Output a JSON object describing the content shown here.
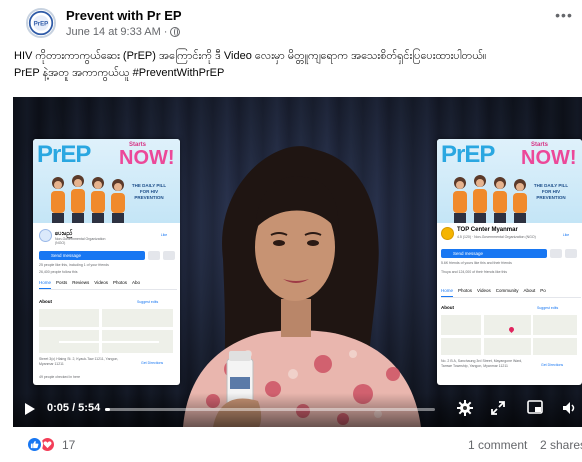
{
  "post": {
    "page_name": "Prevent with Pr EP",
    "timestamp": "June 14 at 9:33 AM",
    "separator": "·",
    "more_icon": "more-dots-icon",
    "privacy_icon": "globe-icon",
    "avatar_text": "PrEP",
    "caption_line1": "HIV ကိုတားကာကွယ်ဆေး (PrEP) အကြောင်းကို ဒီ Video လေးမှာ မိတ္တူကျရောက အသေးစိတ်ရှင်းပြပေးထားပါတယ်။",
    "caption_line2": "PrEP နဲ့အတူ အကာကွယ်ယူ #PreventWithPrEP"
  },
  "video": {
    "time": "0:05 / 5:54",
    "progress": 0.014,
    "controls": [
      "play-icon",
      "gear-icon",
      "expand-icon",
      "miniplayer-icon",
      "volume-icon"
    ],
    "left_card": {
      "banner_prep": "PrEP",
      "banner_starts": "Starts",
      "banner_now": "NOW!",
      "banner_tagline": "THE DAILY PILL FOR HIV PREVENTION",
      "name": "ပေးမည်",
      "sub": "Non-Governmental Organization (NGO)",
      "like_label": "Like",
      "button": "Send message",
      "line1": "25 people like this, including 1 of your friends",
      "line2": "26,400 people follow this",
      "tabs": [
        "Home",
        "Posts",
        "Reviews",
        "Videos",
        "Photos",
        "Abo"
      ],
      "about": "About",
      "suggest": "Suggest edits",
      "address": "Street 3(c) Hlaing St. 2, Kyauk-Taw 11211, Yangon, Myanmar 11211",
      "directions": "Get Directions",
      "checkins": "49 people checked in here"
    },
    "right_card": {
      "banner_prep": "PrEP",
      "banner_starts": "Starts",
      "banner_now": "NOW!",
      "banner_tagline": "THE DAILY PILL FOR HIV PREVENTION",
      "name": "TOP Center Myanmar",
      "sub": "4.5 (120) · Non-Governmental Organization (NGO)",
      "like_label": "Like",
      "button": "Send message",
      "line1": "5.6K friends of yours like this and their friends",
      "line2": "Thuya and 124,000 of their friends like this",
      "tabs": [
        "Home",
        "Photos",
        "Videos",
        "Community",
        "About",
        "Po"
      ],
      "about": "About",
      "suggest": "Suggest edits",
      "address": "No. 2 B A, Sanchaung 3rd Street, Mayangone Ward, Tamwe Township, Yangon, Myanmar 11211",
      "directions": "Get Directions"
    }
  },
  "footer": {
    "reaction_count": "17",
    "comments": "1 comment",
    "shares": "2 shares",
    "reaction_icons": [
      "like-icon",
      "love-icon"
    ]
  },
  "colors": {
    "facebook_blue": "#1877f2",
    "love_red": "#f33e58",
    "secondary_text": "#65676b"
  }
}
